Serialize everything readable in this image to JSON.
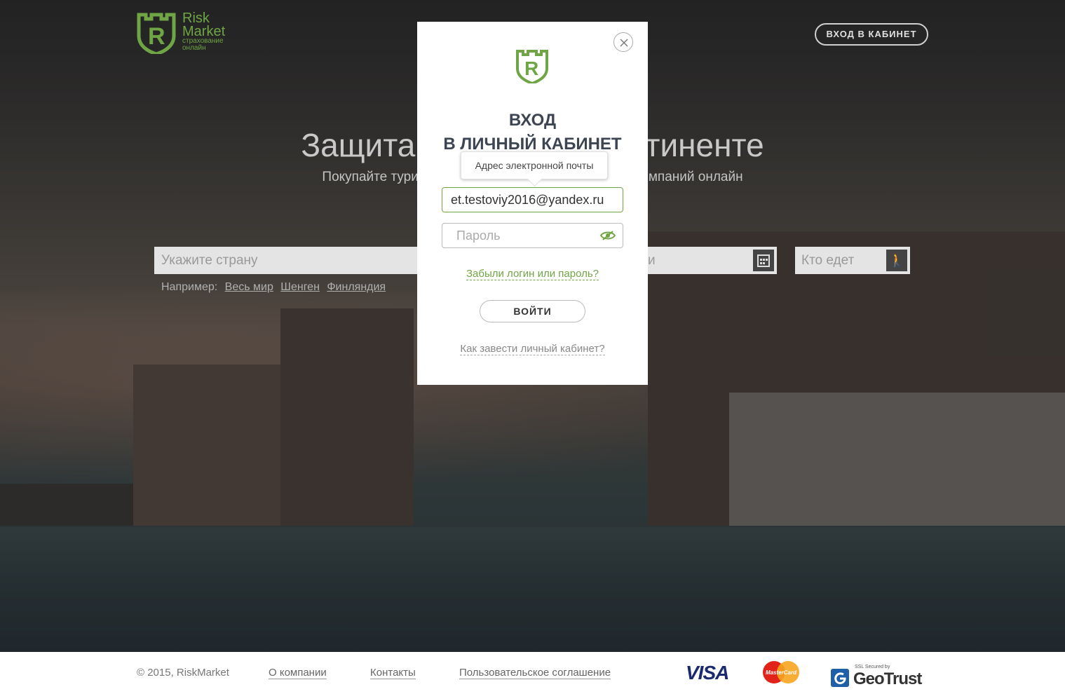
{
  "header": {
    "logo_line1": "Risk",
    "logo_line2": "Market",
    "logo_sub1": "страхование",
    "logo_sub2": "онлайн",
    "cabinet_button": "ВХОД В КАБИНЕТ"
  },
  "hero": {
    "title_left": "Защита",
    "title_right": "тиненте",
    "subtitle_left": "Покупайте тури",
    "subtitle_right": "мпаний онлайн"
  },
  "search": {
    "country_placeholder": "Укажите страну",
    "date_placeholder": "и",
    "who_placeholder": "Кто едет",
    "examples_label": "Например:",
    "examples": [
      "Весь мир",
      "Шенген",
      "Финляндия"
    ]
  },
  "modal": {
    "title_line1": "ВХОД",
    "title_line2": "В ЛИЧНЫЙ КАБИНЕТ",
    "email_tooltip": "Адрес электронной почты",
    "email_value": "et.testoviy2016@yandex.ru",
    "password_placeholder": "Пароль",
    "forgot_link": "Забыли логин или пароль?",
    "login_button": "ВОЙТИ",
    "howto_link": "Как завести личный кабинет?"
  },
  "footer": {
    "copyright": "© 2015, RiskMarket",
    "links": [
      "О компании",
      "Контакты",
      "Пользовательское соглашение"
    ],
    "visa": "VISA",
    "mastercard": "MasterCard",
    "geotrust_small": "SSL Secured by",
    "geotrust": "GeoTrust"
  },
  "colors": {
    "accent": "#6fa544",
    "title": "#3d4552"
  }
}
